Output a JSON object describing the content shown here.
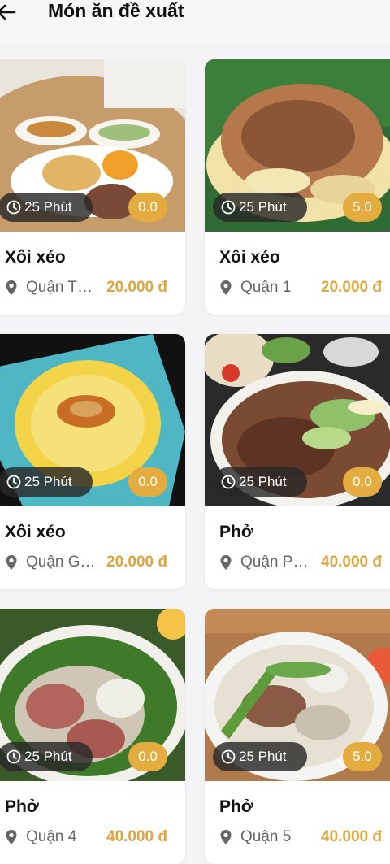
{
  "header": {
    "title": "Món ăn đề xuất"
  },
  "items": [
    {
      "name": "Xôi xéo",
      "time": "25 Phút",
      "rating": "0.0",
      "location": "Quận Tân Bình",
      "price": "20.000 đ"
    },
    {
      "name": "Xôi xéo",
      "time": "25 Phút",
      "rating": "5.0",
      "location": "Quận 1",
      "price": "20.000 đ"
    },
    {
      "name": "Xôi xéo",
      "time": "25 Phút",
      "rating": "0.0",
      "location": "Quận Gò Vấp",
      "price": "20.000 đ"
    },
    {
      "name": "Phở",
      "time": "25 Phút",
      "rating": "0.0",
      "location": "Quận Phú Nhuận",
      "price": "40.000 đ"
    },
    {
      "name": "Phở",
      "time": "25 Phút",
      "rating": "0.0",
      "location": "Quận 4",
      "price": "40.000 đ"
    },
    {
      "name": "Phở",
      "time": "25 Phút",
      "rating": "5.0",
      "location": "Quận 5",
      "price": "40.000 đ"
    }
  ]
}
